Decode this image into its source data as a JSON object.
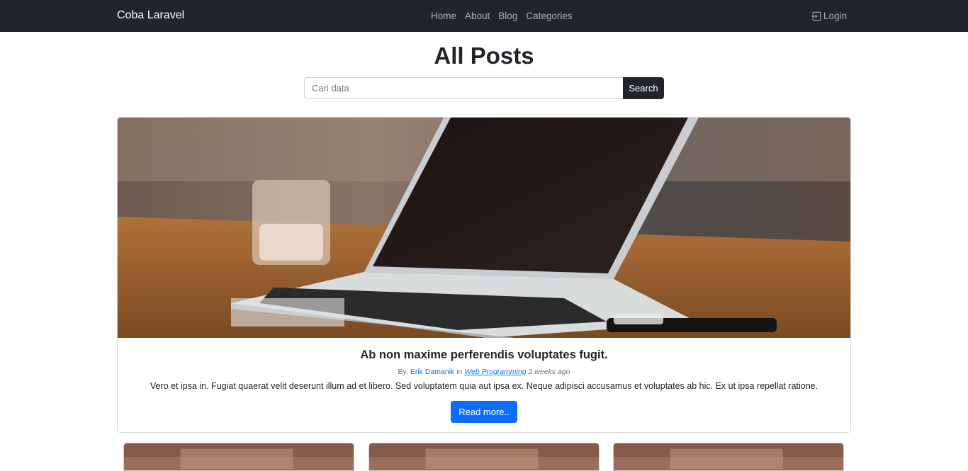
{
  "navbar": {
    "brand": "Coba Laravel",
    "links": [
      "Home",
      "About",
      "Blog",
      "Categories"
    ],
    "login": "Login"
  },
  "page": {
    "title": "All Posts"
  },
  "search": {
    "placeholder": "Cari data",
    "button_label": "Search"
  },
  "featured_post": {
    "title": "Ab non maxime perferendis voluptates fugit.",
    "meta_by": "By.",
    "author": "Erik Damanik",
    "meta_in": "in",
    "category": "Web Programming",
    "time_ago": "2 weeks ago",
    "excerpt": "Vero et ipsa in. Fugiat quaerat velit deserunt illum ad et libero. Sed voluptatem quia aut ipsa ex. Neque adipisci accusamus et voluptates ab hic. Ex ut ipsa repellat ratione.",
    "read_more": "Read more..",
    "image_icon": "laptop-photo"
  },
  "colors": {
    "navbar_bg": "#212529",
    "primary": "#0d6efd"
  }
}
